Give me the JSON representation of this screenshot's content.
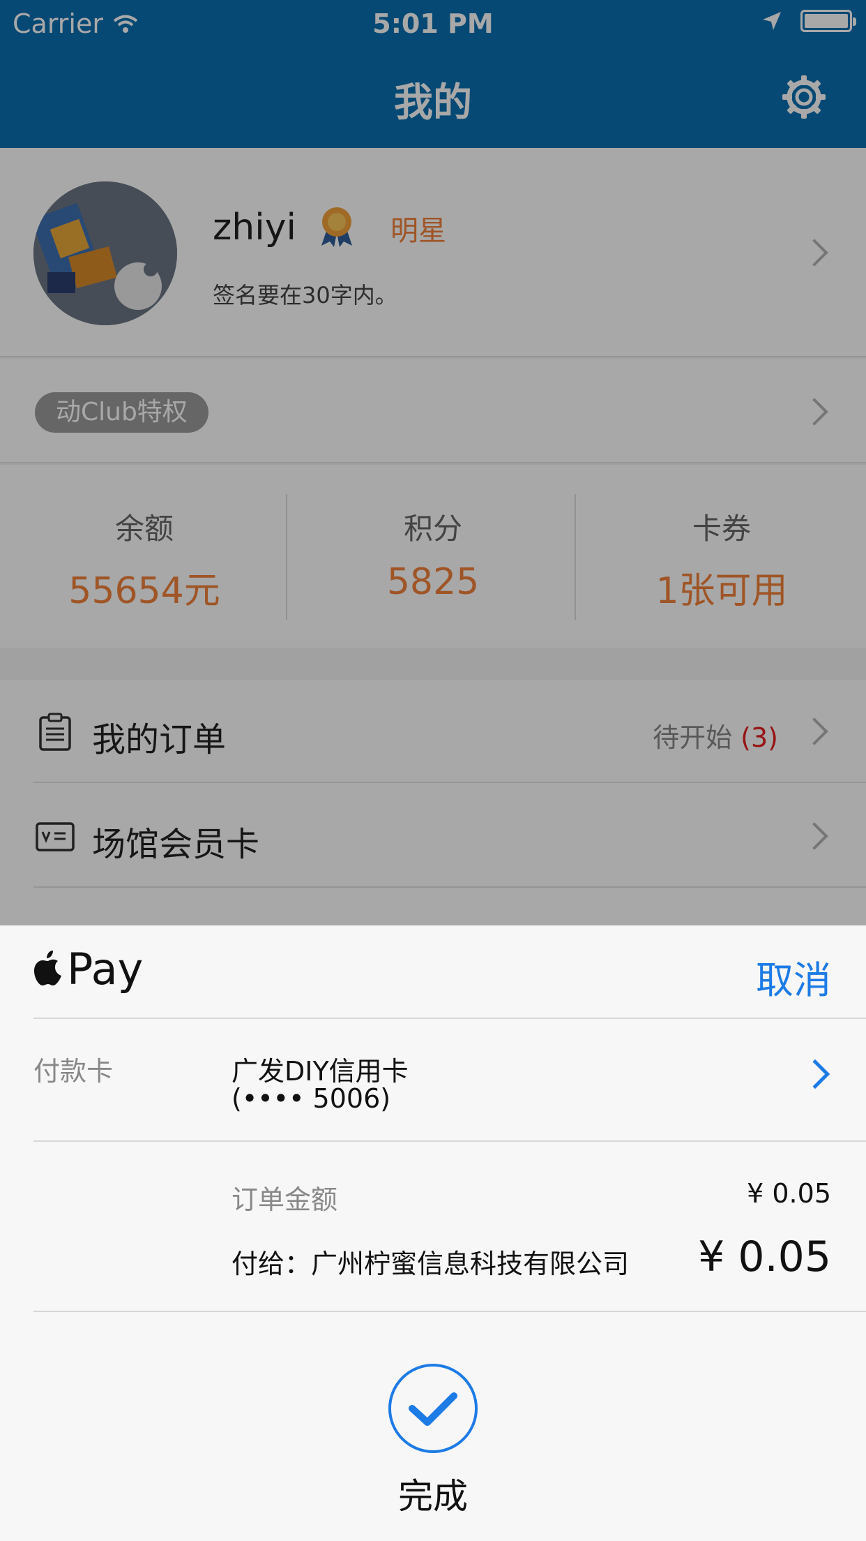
{
  "status_bar": {
    "carrier": "Carrier",
    "time": "5:01 PM"
  },
  "nav": {
    "title": "我的",
    "settings_icon": "gear-icon"
  },
  "profile": {
    "username": "zhiyi",
    "rank": "明星",
    "signature": "签名要在30字内。"
  },
  "club": {
    "badge": "动Club特权"
  },
  "stats": [
    {
      "label": "余额",
      "value": "55654元"
    },
    {
      "label": "积分",
      "value": "5825"
    },
    {
      "label": "卡券",
      "value": "1张可用"
    }
  ],
  "menu": {
    "orders": {
      "label": "我的订单",
      "status": "待开始",
      "count": "(3)"
    },
    "member_card": {
      "label": "场馆会员卡"
    }
  },
  "apple_pay": {
    "title": "Pay",
    "cancel": "取消",
    "card_label": "付款卡",
    "card_name": "广发DIY信用卡",
    "card_number": "(•••• 5006)",
    "amount_label": "订单金额",
    "amount_value": "¥  0.05",
    "payee": "付给：广州柠蜜信息科技有限公司",
    "total": "¥  0.05",
    "done_label": "完成"
  },
  "colors": {
    "nav_blue": "#0a6fb0",
    "accent_orange": "#f2813a",
    "link_blue": "#1d7be6",
    "badge_red": "#e52020"
  }
}
